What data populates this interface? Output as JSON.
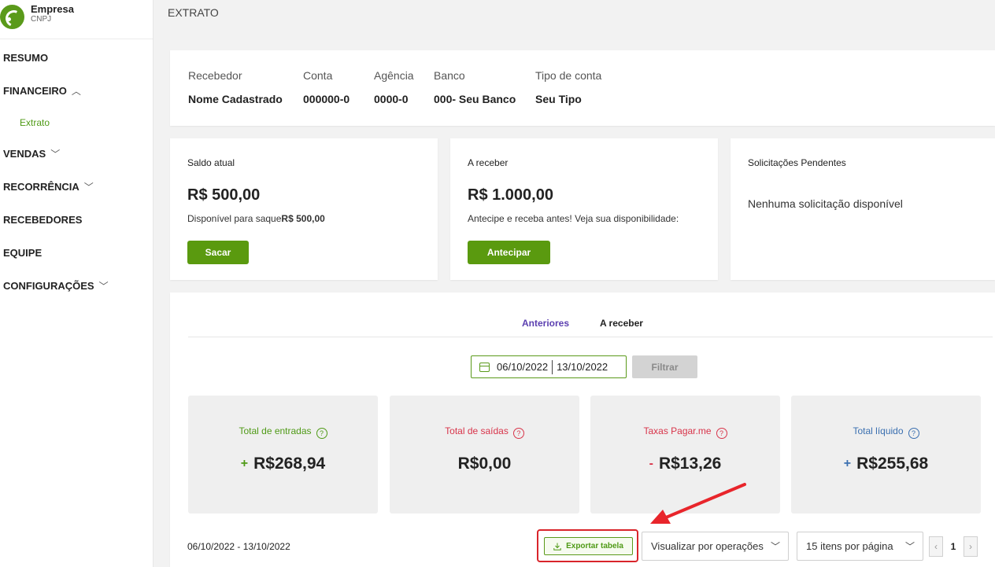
{
  "brand": {
    "name": "Empresa",
    "subtitle": "CNPJ"
  },
  "sidebar": {
    "items": [
      {
        "label": "RESUMO"
      },
      {
        "label": "FINANCEIRO",
        "chevron": "chevron-up"
      },
      {
        "label": "Extrato",
        "sub": true
      },
      {
        "label": "VENDAS",
        "chevron": "chevron-down"
      },
      {
        "label": "RECORRÊNCIA",
        "chevron": "chevron-down"
      },
      {
        "label": "RECEBEDORES"
      },
      {
        "label": "EQUIPE"
      },
      {
        "label": "CONFIGURAÇÕES",
        "chevron": "chevron-down"
      }
    ]
  },
  "page": {
    "title": "EXTRATO"
  },
  "account": {
    "columns": [
      {
        "header": "Recebedor",
        "value": "Nome Cadastrado"
      },
      {
        "header": "Conta",
        "value": "000000-0"
      },
      {
        "header": "Agência",
        "value": "0000-0"
      },
      {
        "header": "Banco",
        "value": "000- Seu Banco"
      },
      {
        "header": "Tipo de conta",
        "value": "Seu Tipo"
      }
    ]
  },
  "balance": {
    "title": "Saldo atual",
    "amount": "R$ 500,00",
    "note_prefix": "Disponível para saque",
    "note_value": "R$ 500,00",
    "button": "Sacar"
  },
  "receivable": {
    "title": "A receber",
    "amount": "R$ 1.000,00",
    "note": "Antecipe e receba antes! Veja sua disponibilidade:",
    "button": "Antecipar"
  },
  "pending": {
    "title": "Solicitações Pendentes",
    "message": "Nenhuma solicitação disponível"
  },
  "tabs": [
    {
      "label": "Anteriores",
      "active": true
    },
    {
      "label": "A receber",
      "active": false
    }
  ],
  "filter": {
    "start_date": "06/10/2022",
    "end_date": "13/10/2022",
    "button": "Filtrar"
  },
  "stats": [
    {
      "label": "Total de entradas",
      "sign": "+",
      "value": "R$268,94",
      "color": "#4f9a16"
    },
    {
      "label": "Total de saídas",
      "sign": "",
      "value": "R$0,00",
      "color": "#d8344a"
    },
    {
      "label": "Taxas Pagar.me",
      "sign": "-",
      "value": "R$13,26",
      "color": "#d8344a"
    },
    {
      "label": "Total líquido",
      "sign": "+",
      "value": "R$255,68",
      "color": "#3a6fb0"
    }
  ],
  "footer": {
    "range": "06/10/2022 - 13/10/2022",
    "export_button": "Exportar tabela",
    "view_select": "Visualizar por operações",
    "per_page_select": "15 itens por página",
    "current_page": "1"
  },
  "colors": {
    "accent_green": "#5a9a0f",
    "highlight_red": "#d9252b",
    "tab_active": "#5b3fb0"
  }
}
